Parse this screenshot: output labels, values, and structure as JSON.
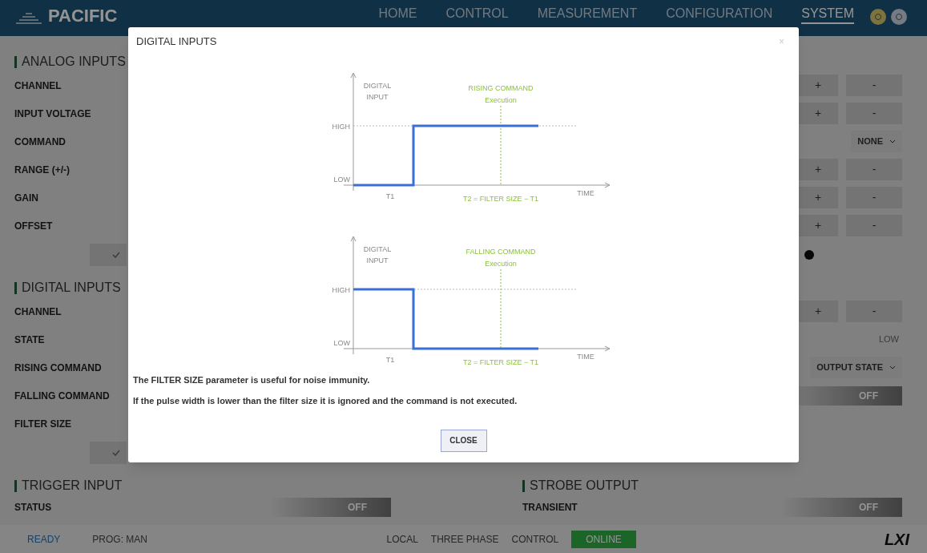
{
  "header": {
    "logo": "PACIFIC",
    "nav": [
      {
        "label": "HOME",
        "selected": false
      },
      {
        "label": "CONTROL",
        "selected": false
      },
      {
        "label": "MEASUREMENT",
        "selected": false
      },
      {
        "label": "CONFIGURATION",
        "selected": false
      },
      {
        "label": "SYSTEM",
        "selected": true
      }
    ]
  },
  "analog_inputs": {
    "title": "ANALOG INPUTS",
    "rows": [
      {
        "label": "CHANNEL",
        "kind": "stepper",
        "plus": "+",
        "minus": "-"
      },
      {
        "label": "INPUT VOLTAGE",
        "kind": "stepper",
        "plus": "+",
        "minus": "-"
      },
      {
        "label": "COMMAND",
        "kind": "dropdown",
        "value": "NONE"
      },
      {
        "label": "RANGE (+/-)",
        "kind": "stepper",
        "plus": "+",
        "minus": "-"
      },
      {
        "label": "GAIN",
        "kind": "stepper",
        "plus": "+",
        "minus": "-"
      },
      {
        "label": "OFFSET",
        "kind": "stepper",
        "plus": "+",
        "minus": "-"
      }
    ]
  },
  "digital_inputs": {
    "title": "DIGITAL INPUTS",
    "rows": [
      {
        "label": "CHANNEL",
        "kind": "stepper",
        "plus": "+",
        "minus": "-"
      },
      {
        "label": "STATE",
        "kind": "readout",
        "value": "LOW"
      },
      {
        "label": "RISING COMMAND",
        "kind": "dropdown",
        "value": "OUTPUT STATE"
      },
      {
        "label": "FALLING COMMAND",
        "kind": "toggle",
        "value": "OFF",
        "on": false
      },
      {
        "label": "FILTER SIZE",
        "kind": "blank"
      }
    ]
  },
  "trigger_input": {
    "title": "TRIGGER INPUT",
    "rows": [
      {
        "label": "STATUS",
        "kind": "toggle",
        "value": "OFF",
        "on": false
      }
    ]
  },
  "strobe_output": {
    "title": "STROBE OUTPUT",
    "rows": [
      {
        "label": "TRANSIENT",
        "kind": "toggle",
        "value": "OFF",
        "on": false
      }
    ]
  },
  "status_bar": {
    "left": [
      {
        "text": "READY",
        "kind": "state"
      },
      {
        "text": "PROG: MAN",
        "kind": "plain"
      }
    ],
    "right": [
      {
        "text": "LOCAL",
        "kind": "plain"
      },
      {
        "text": "THREE PHASE",
        "kind": "plain"
      },
      {
        "text": "CONTROL",
        "kind": "plain"
      },
      {
        "text": "ONLINE",
        "kind": "badge"
      }
    ],
    "logo": "LXI"
  },
  "dialog": {
    "title": "DIGITAL INPUTS",
    "close_icon": "×",
    "diagrams": [
      {
        "kind": "rising",
        "axis_label": [
          "DIGITAL",
          "INPUT"
        ],
        "high": "HIGH",
        "low": "LOW",
        "t1": "T1",
        "time": "TIME",
        "event": [
          "RISING COMMAND",
          "Execution"
        ],
        "formula": "T2 = FILTER SIZE − T1"
      },
      {
        "kind": "falling",
        "axis_label": [
          "DIGITAL",
          "INPUT"
        ],
        "high": "HIGH",
        "low": "LOW",
        "t1": "T1",
        "time": "TIME",
        "event": [
          "FALLING COMMAND",
          "Execution"
        ],
        "formula": "T2 = FILTER SIZE − T1"
      }
    ],
    "notes": [
      "The FILTER SIZE parameter is useful for noise immunity.",
      "If the pulse width is lower than the filter size it is ignored and the command is not executed."
    ],
    "close_button": "CLOSE"
  }
}
